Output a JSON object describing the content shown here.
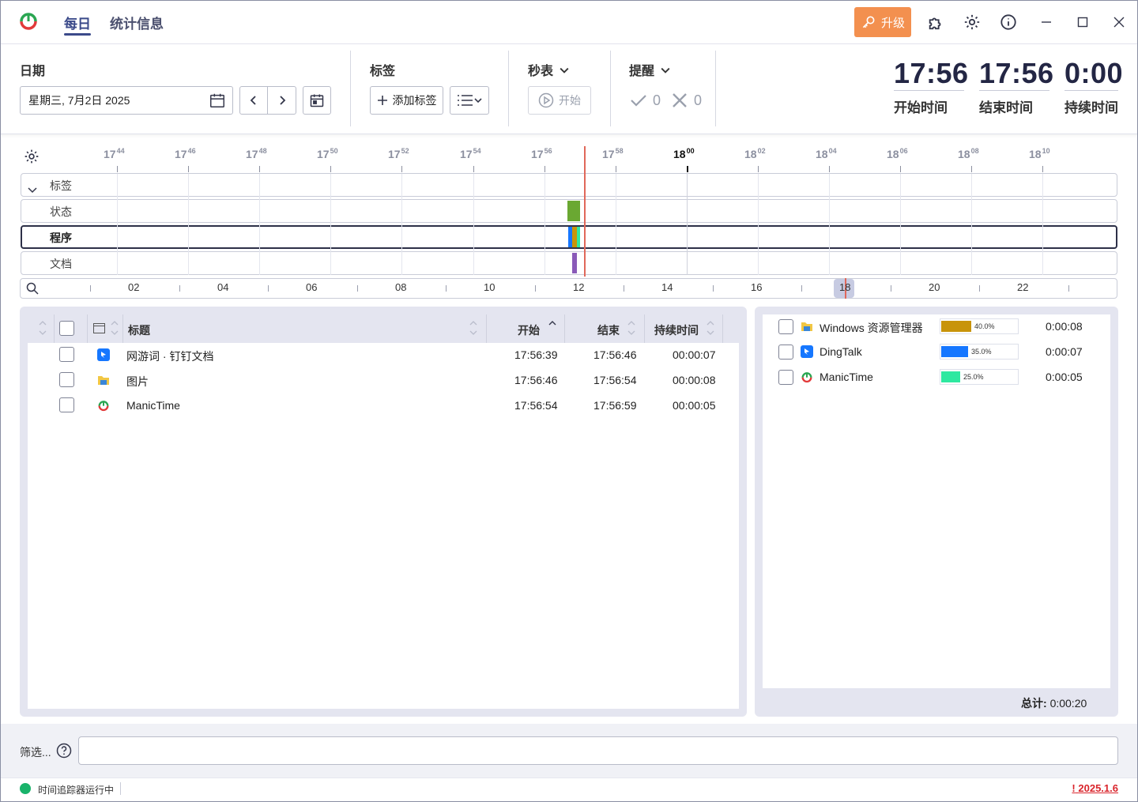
{
  "nav": {
    "tabs": [
      "每日",
      "统计信息"
    ],
    "upgrade_label": "升级"
  },
  "toolbar": {
    "date_label": "日期",
    "date_value": "星期三, 7月2日 2025",
    "tags_label": "标签",
    "add_tag_label": "添加标签",
    "stopwatch_label": "秒表",
    "start_label": "开始",
    "reminder_label": "提醒",
    "reminder_done": "0",
    "reminder_missed": "0",
    "start_time": "17:56",
    "end_time": "17:56",
    "duration": "0:00",
    "start_time_label": "开始时间",
    "end_time_label": "结束时间",
    "duration_label": "持续时间"
  },
  "timeline": {
    "ticks": [
      {
        "h": "17",
        "m": "44"
      },
      {
        "h": "17",
        "m": "46"
      },
      {
        "h": "17",
        "m": "48"
      },
      {
        "h": "17",
        "m": "50"
      },
      {
        "h": "17",
        "m": "52"
      },
      {
        "h": "17",
        "m": "54"
      },
      {
        "h": "17",
        "m": "56"
      },
      {
        "h": "17",
        "m": "58"
      },
      {
        "h": "18",
        "m": "00"
      },
      {
        "h": "18",
        "m": "02"
      },
      {
        "h": "18",
        "m": "04"
      },
      {
        "h": "18",
        "m": "06"
      },
      {
        "h": "18",
        "m": "08"
      },
      {
        "h": "18",
        "m": "10"
      }
    ],
    "lanes": [
      "标签",
      "状态",
      "程序",
      "文档"
    ],
    "mini_labels": [
      "02",
      "04",
      "06",
      "08",
      "10",
      "12",
      "14",
      "16",
      "18",
      "20",
      "22"
    ],
    "colors": {
      "status": "#6aa832",
      "doc": "#8a5ab8",
      "now": "#e0685a"
    }
  },
  "table": {
    "headers": {
      "title": "标题",
      "start": "开始",
      "end": "结束",
      "duration": "持续时间"
    },
    "rows": [
      {
        "title": "网游词 · 钉钉文档",
        "start": "17:56:39",
        "end": "17:56:46",
        "duration": "00:00:07",
        "icon": "dingtalk-icon"
      },
      {
        "title": "图片",
        "start": "17:56:46",
        "end": "17:56:54",
        "duration": "00:00:08",
        "icon": "folder-icon"
      },
      {
        "title": "ManicTime",
        "start": "17:56:54",
        "end": "17:56:59",
        "duration": "00:00:05",
        "icon": "manictime-icon"
      }
    ]
  },
  "stats": {
    "items": [
      {
        "name": "Windows 资源管理器",
        "percent": "40.0%",
        "fraction": 0.4,
        "duration": "0:00:08",
        "color": "#c8940a",
        "icon": "folder-icon"
      },
      {
        "name": "DingTalk",
        "percent": "35.0%",
        "fraction": 0.35,
        "duration": "0:00:07",
        "color": "#1677ff",
        "icon": "dingtalk-icon"
      },
      {
        "name": "ManicTime",
        "percent": "25.0%",
        "fraction": 0.25,
        "duration": "0:00:05",
        "color": "#2ee8a0",
        "icon": "manictime-icon"
      }
    ],
    "total_label": "总计:",
    "total_value": "0:00:20"
  },
  "filter": {
    "label": "筛选...",
    "value": ""
  },
  "status": {
    "text": "时间追踪器运行中",
    "version_prefix": "!",
    "version": "2025.1.6"
  }
}
